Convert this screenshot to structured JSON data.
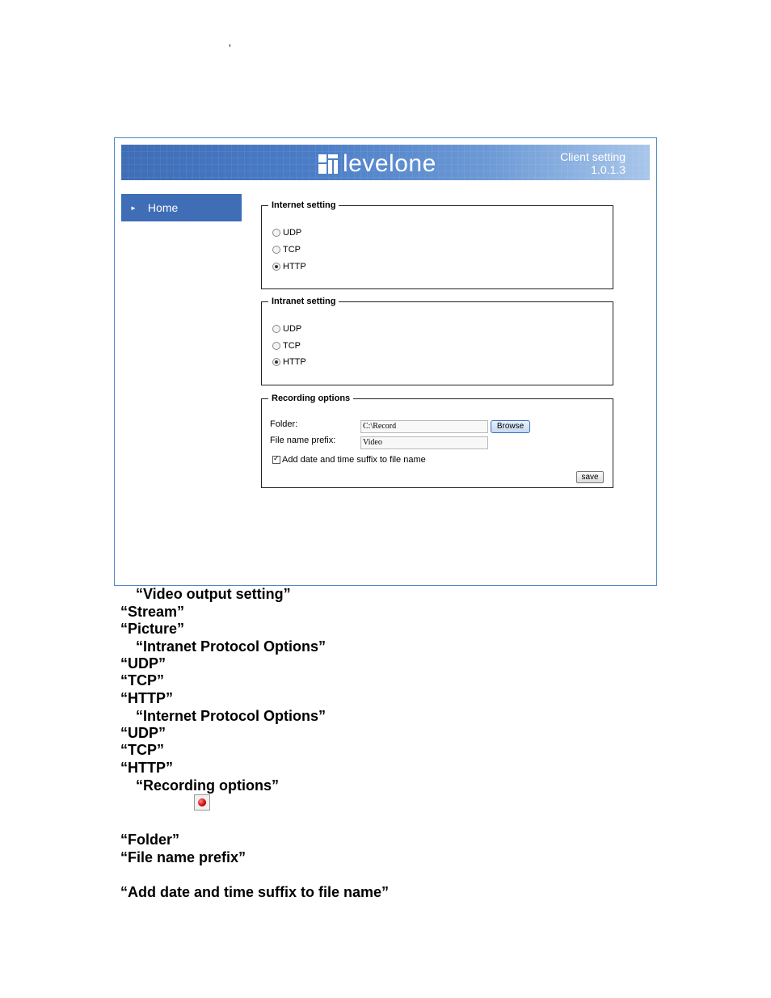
{
  "stray_mark": "’",
  "screenshot": {
    "banner": {
      "logo_text": "levelone",
      "title_line1": "Client setting",
      "title_line2": "1.0.1.3"
    },
    "nav": {
      "home_label": "Home"
    },
    "internet_setting": {
      "legend": "Internet setting",
      "options": [
        "UDP",
        "TCP",
        "HTTP"
      ],
      "selected": "HTTP"
    },
    "intranet_setting": {
      "legend": "Intranet setting",
      "options": [
        "UDP",
        "TCP",
        "HTTP"
      ],
      "selected": "HTTP"
    },
    "recording_options": {
      "legend": "Recording options",
      "folder_label": "Folder:",
      "folder_value": "C:\\Record",
      "browse_label": "Browse",
      "prefix_label": "File name prefix:",
      "prefix_value": "Video",
      "suffix_label": "Add date and time suffix to file name",
      "suffix_checked": true,
      "save_label": "save"
    }
  },
  "document_lines": [
    "“Video output setting”",
    "“Stream”",
    "“Picture”",
    "“Intranet Protocol Options”",
    "“UDP”",
    "“TCP”",
    "“HTTP”",
    "“Internet Protocol Options”",
    "“UDP”",
    "“TCP”",
    "“HTTP”",
    "“Recording options”",
    "“Folder”",
    "“File name prefix”",
    "“Add date and time suffix to file name”"
  ],
  "icons": {
    "record_icon": "record-icon"
  }
}
